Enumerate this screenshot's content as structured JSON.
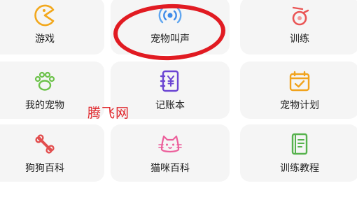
{
  "tiles": [
    {
      "label": "游戏",
      "icon": "pacman-icon"
    },
    {
      "label": "宠物叫声",
      "icon": "pet-sound-icon"
    },
    {
      "label": "训练",
      "icon": "whistle-icon"
    },
    {
      "label": "我的宠物",
      "icon": "paw-icon"
    },
    {
      "label": "记账本",
      "icon": "ledger-icon"
    },
    {
      "label": "宠物计划",
      "icon": "calendar-check-icon"
    },
    {
      "label": "狗狗百科",
      "icon": "bone-icon"
    },
    {
      "label": "猫咪百科",
      "icon": "cat-face-icon"
    },
    {
      "label": "训练教程",
      "icon": "book-icon"
    }
  ],
  "watermark": "腾飞网",
  "colors": {
    "tile_bg": "#f5f5f5",
    "pacman": "#f2a81d",
    "sound": "#3f8be9",
    "whistle": "#ea5454",
    "paw": "#6cc24a",
    "ledger": "#6b45d3",
    "calendar": "#f1a31d",
    "bone": "#e24e4e",
    "cat": "#ec5f9b",
    "book": "#56b24d",
    "annotation": "#e11b22"
  }
}
